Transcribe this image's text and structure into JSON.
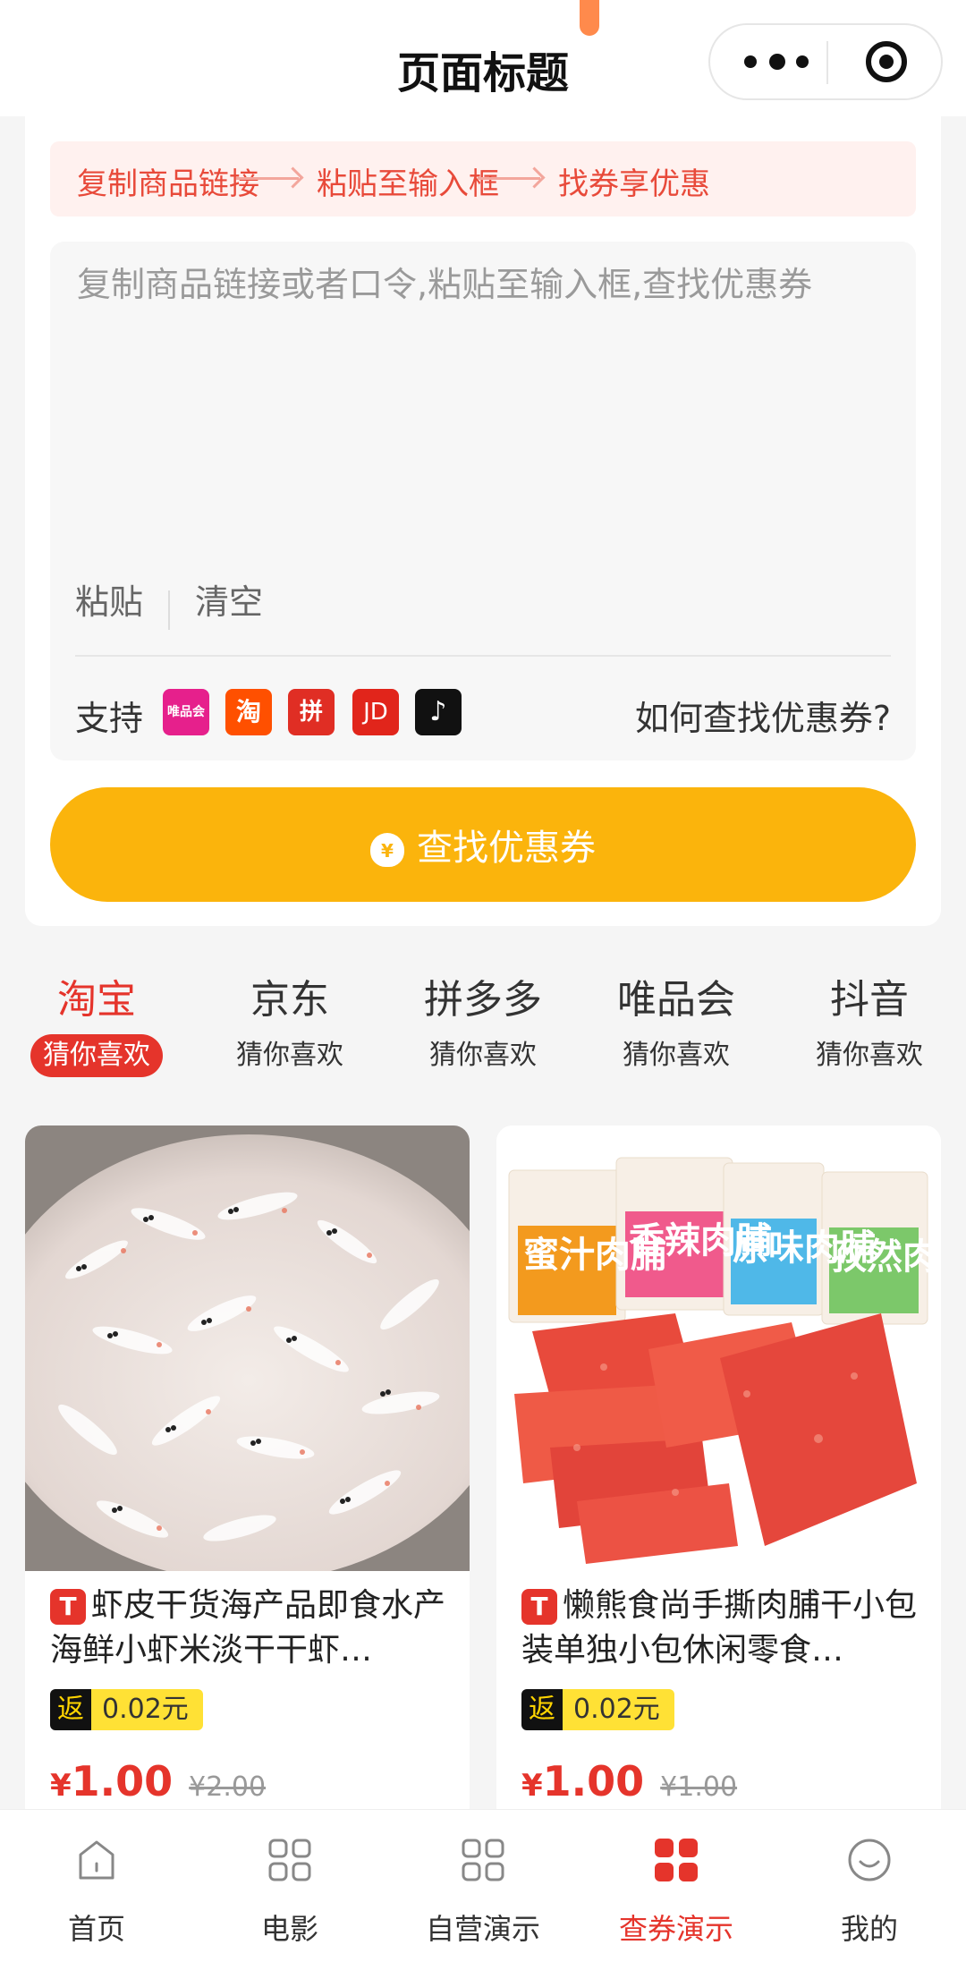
{
  "header": {
    "title": "页面标题"
  },
  "steps": [
    "复制商品链接",
    "粘贴至输入框",
    "找券享优惠"
  ],
  "input": {
    "placeholder": "复制商品链接或者口令,粘贴至输入框,查找优惠券",
    "paste_label": "粘贴",
    "clear_label": "清空"
  },
  "support": {
    "label": "支持",
    "platforms": [
      {
        "icon": "vipshop-icon",
        "text": "唯品会",
        "color": "#e6208c"
      },
      {
        "icon": "taobao-icon",
        "text": "淘",
        "color": "#ff5000"
      },
      {
        "icon": "pinduoduo-icon",
        "text": "拼",
        "color": "#e02e24"
      },
      {
        "icon": "jd-icon",
        "text": "JD",
        "color": "#e1251b"
      },
      {
        "icon": "douyin-icon",
        "text": "♪",
        "color": "#111111"
      }
    ],
    "howto": "如何查找优惠券?"
  },
  "find_button": {
    "label": "查找优惠券"
  },
  "tabs": [
    {
      "name": "淘宝",
      "sub": "猜你喜欢",
      "active": true
    },
    {
      "name": "京东",
      "sub": "猜你喜欢",
      "active": false
    },
    {
      "name": "拼多多",
      "sub": "猜你喜欢",
      "active": false
    },
    {
      "name": "唯品会",
      "sub": "猜你喜欢",
      "active": false
    },
    {
      "name": "抖音",
      "sub": "猜你喜欢",
      "active": false
    }
  ],
  "products": [
    {
      "title": "虾皮干货海产品即食水产海鲜小虾米淡干干虾…",
      "source_badge": "T",
      "rebate_tag": "返",
      "rebate": "0.02元",
      "currency": "¥",
      "price": "1.00",
      "original_price": "¥2.00"
    },
    {
      "title": "懒熊食尚手撕肉脯干小包装单独小包休闲零食…",
      "source_badge": "T",
      "rebate_tag": "返",
      "rebate": "0.02元",
      "currency": "¥",
      "price": "1.00",
      "original_price": "¥1.00",
      "packages": [
        "蜜汁肉脯",
        "香辣肉脯",
        "原味肉脯",
        "孜然肉脯"
      ]
    }
  ],
  "bottom_nav": [
    {
      "label": "首页",
      "icon": "home-icon",
      "active": false
    },
    {
      "label": "电影",
      "icon": "grid-icon",
      "active": false
    },
    {
      "label": "自营演示",
      "icon": "grid-icon",
      "active": false
    },
    {
      "label": "查券演示",
      "icon": "grid-icon",
      "active": true
    },
    {
      "label": "我的",
      "icon": "smile-icon",
      "active": false
    }
  ],
  "colors": {
    "accent": "#e5342b",
    "button": "#fbb40c",
    "rebate": "#ffe135"
  }
}
